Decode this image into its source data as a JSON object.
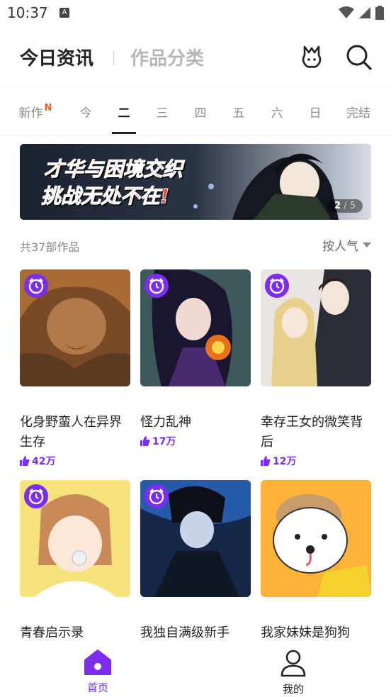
{
  "status": {
    "time": "10:37",
    "notif_icon": "A"
  },
  "header": {
    "tab_active": "今日资讯",
    "tab_inactive": "作品分类"
  },
  "day_tabs": [
    "新作",
    "今",
    "二",
    "三",
    "四",
    "五",
    "六",
    "日",
    "完结"
  ],
  "new_badge": "N",
  "banner": {
    "line1": "才华与困境交织",
    "line2": "挑战无处不在!",
    "pager_current": "2",
    "pager_total": "/ 5"
  },
  "list": {
    "count": "共37部作品",
    "sort": "按人气"
  },
  "cards": [
    {
      "title": "化身野蛮人在异界生存",
      "likes": "42万"
    },
    {
      "title": "怪力乱神",
      "likes": "17万"
    },
    {
      "title": "幸存王女的微笑背后",
      "likes": "12万"
    },
    {
      "title": "青春启示录"
    },
    {
      "title": "我独自满级新手"
    },
    {
      "title": "我家妹妹是狗狗"
    }
  ],
  "nav": {
    "home": "首页",
    "mine": "我的"
  },
  "colors": {
    "accent": "#7b2df0",
    "new_badge": "#ff5a1f",
    "banner_text": "#ff3b30"
  }
}
